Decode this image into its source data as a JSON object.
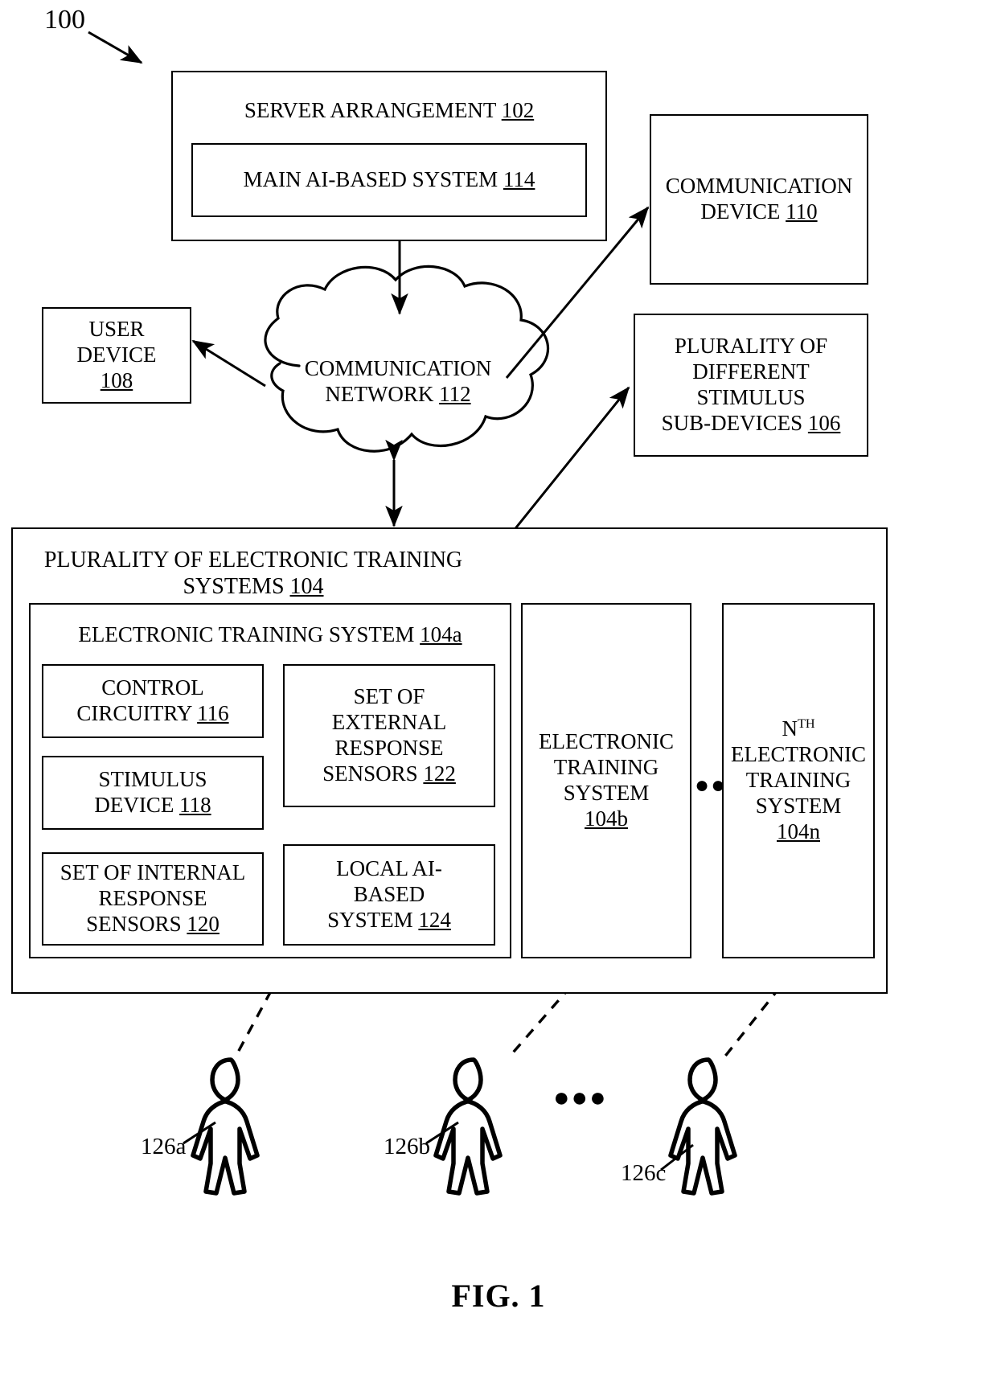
{
  "figure": {
    "reference_numeral": "100",
    "caption": "FIG. 1"
  },
  "blocks": {
    "server_arrangement": {
      "label": "SERVER ARRANGEMENT",
      "numeral": "102"
    },
    "main_ai_system": {
      "label": "MAIN AI-BASED SYSTEM",
      "numeral": "114"
    },
    "communication_device": {
      "line1": "COMMUNICATION",
      "line2": "DEVICE",
      "numeral": "110"
    },
    "user_device": {
      "line1": "USER",
      "line2": "DEVICE",
      "numeral": "108"
    },
    "communication_network": {
      "line1": "COMMUNICATION",
      "line2": "NETWORK",
      "numeral": "112"
    },
    "stimulus_sub_devices": {
      "line1": "PLURALITY OF",
      "line2": "DIFFERENT",
      "line3": "STIMULUS",
      "line4": "SUB-DEVICES",
      "numeral": "106"
    },
    "plurality_training_systems": {
      "line1": "PLURALITY OF ELECTRONIC TRAINING",
      "line2": "SYSTEMS",
      "numeral": "104"
    },
    "training_system_a": {
      "label": "ELECTRONIC TRAINING SYSTEM",
      "numeral": "104a"
    },
    "control_circuitry": {
      "line1": "CONTROL",
      "line2": "CIRCUITRY",
      "numeral": "116"
    },
    "stimulus_device": {
      "line1": "STIMULUS",
      "line2": "DEVICE",
      "numeral": "118"
    },
    "internal_sensors": {
      "line1": "SET OF INTERNAL",
      "line2": "RESPONSE",
      "line3": "SENSORS",
      "numeral": "120"
    },
    "external_sensors": {
      "line1": "SET OF",
      "line2": "EXTERNAL",
      "line3": "RESPONSE",
      "line4": "SENSORS",
      "numeral": "122"
    },
    "local_ai_system": {
      "line1": "LOCAL AI-",
      "line2": "BASED",
      "line3": "SYSTEM",
      "numeral": "124"
    },
    "training_system_b": {
      "line1": "ELECTRONIC",
      "line2": "TRAINING",
      "line3": "SYSTEM",
      "numeral": "104b"
    },
    "training_system_n": {
      "prefix": "N",
      "superscript": "TH",
      "line2": "ELECTRONIC",
      "line3": "TRAINING",
      "line4": "SYSTEM",
      "numeral": "104n"
    }
  },
  "people": {
    "person_a": "126a",
    "person_b": "126b",
    "person_c": "126c"
  },
  "ellipsis": {
    "between_systems": "●●●",
    "between_people": "●●●"
  },
  "style": {
    "line_color": "#000000",
    "background": "#ffffff"
  }
}
